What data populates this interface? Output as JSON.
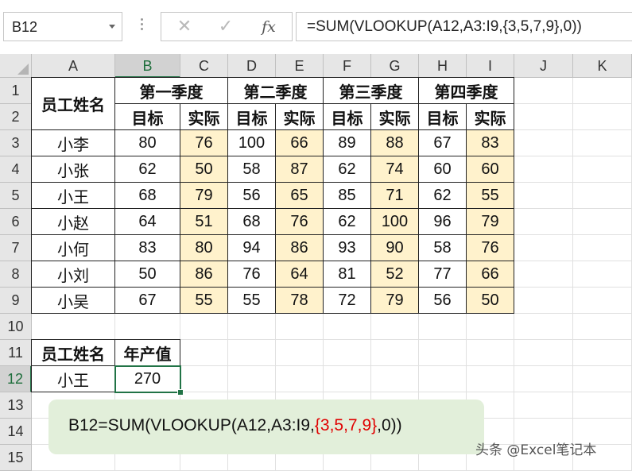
{
  "name_box": {
    "value": "B12"
  },
  "formula_bar": {
    "cancel_glyph": "✕",
    "enter_glyph": "✓",
    "fx_label": "fx",
    "formula": "=SUM(VLOOKUP(A12,A3:I9,{3,5,7,9},0))"
  },
  "columns": [
    "A",
    "B",
    "C",
    "D",
    "E",
    "F",
    "G",
    "H",
    "I",
    "J",
    "K"
  ],
  "rows": [
    "1",
    "2",
    "3",
    "4",
    "5",
    "6",
    "7",
    "8",
    "9",
    "10",
    "11",
    "12",
    "13",
    "14",
    "15"
  ],
  "table": {
    "name_header": "员工姓名",
    "quarters": [
      "第一季度",
      "第二季度",
      "第三季度",
      "第四季度"
    ],
    "target_label": "目标",
    "actual_label": "实际",
    "data": [
      [
        "小李",
        "80",
        "76",
        "100",
        "66",
        "89",
        "88",
        "67",
        "83"
      ],
      [
        "小张",
        "62",
        "50",
        "58",
        "87",
        "62",
        "74",
        "60",
        "60"
      ],
      [
        "小王",
        "68",
        "79",
        "56",
        "65",
        "85",
        "71",
        "62",
        "55"
      ],
      [
        "小赵",
        "64",
        "51",
        "68",
        "76",
        "62",
        "100",
        "96",
        "79"
      ],
      [
        "小何",
        "83",
        "80",
        "94",
        "86",
        "93",
        "90",
        "58",
        "76"
      ],
      [
        "小刘",
        "50",
        "86",
        "76",
        "64",
        "81",
        "52",
        "77",
        "66"
      ],
      [
        "小吴",
        "67",
        "55",
        "55",
        "78",
        "72",
        "79",
        "56",
        "50"
      ]
    ]
  },
  "lookup": {
    "name_header": "员工姓名",
    "value_header": "年产值",
    "name": "小王",
    "value": "270"
  },
  "note": {
    "prefix": "B12=SUM(VLOOKUP(A12,A3:I9,",
    "highlight": "{3,5,7,9}",
    "suffix": ",0))"
  },
  "watermark": "头条 @Excel笔记本",
  "colors": {
    "accent": "#217346",
    "actual_fill": "#fff2cc",
    "note_fill": "#e2efda",
    "highlight": "#e00000"
  }
}
